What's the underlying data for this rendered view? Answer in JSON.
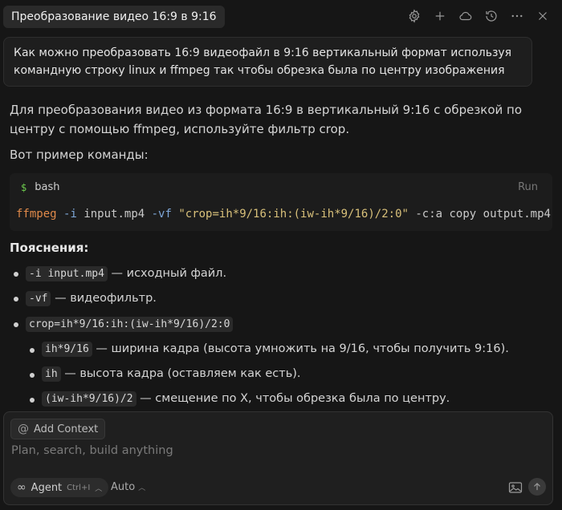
{
  "header": {
    "title": "Преобразование видео 16:9 в 9:16",
    "icons": [
      "gear-icon",
      "plus-icon",
      "cloud-icon",
      "history-icon",
      "more-icon",
      "close-icon"
    ]
  },
  "user_message": "Как можно преобразовать 16:9 видеофайл в 9:16 вертикальный формат используя командную строку linux и ffmpeg так чтобы обрезка была по центру изображения",
  "assistant": {
    "intro": "Для преобразования видео из формата 16:9 в вертикальный 9:16 с обрезкой по центру с помощью ffmpeg, используйте фильтр crop.",
    "example_label": "Вот пример команды:",
    "code": {
      "lang": "bash",
      "run_label": "Run",
      "cmd": "ffmpeg",
      "flag_i": "-i",
      "input": "input.mp4",
      "flag_vf": "-vf",
      "filter": "\"crop=ih*9/16:ih:(iw-ih*9/16)/2:0\"",
      "rest": "-c:a copy output.mp4"
    },
    "explain_title": "Пояснения:",
    "bullets": [
      {
        "code": "-i input.mp4",
        "text": " — исходный файл."
      },
      {
        "code": "-vf",
        "text": " — видеофильтр."
      },
      {
        "code": "crop=ih*9/16:ih:(iw-ih*9/16)/2:0",
        "text": ""
      }
    ],
    "sub_bullets": [
      {
        "code": "ih*9/16",
        "text": " — ширина кадра (высота умножить на 9/16, чтобы получить 9:16)."
      },
      {
        "code": "ih",
        "text": " — высота кадра (оставляем как есть)."
      },
      {
        "code": "(iw-ih*9/16)/2",
        "text": " — смещение по X, чтобы обрезка была по центру."
      }
    ]
  },
  "composer": {
    "add_context": "Add Context",
    "placeholder": "Plan, search, build anything",
    "agent_label": "Agent",
    "agent_shortcut": "Ctrl+I",
    "model": "Auto"
  }
}
